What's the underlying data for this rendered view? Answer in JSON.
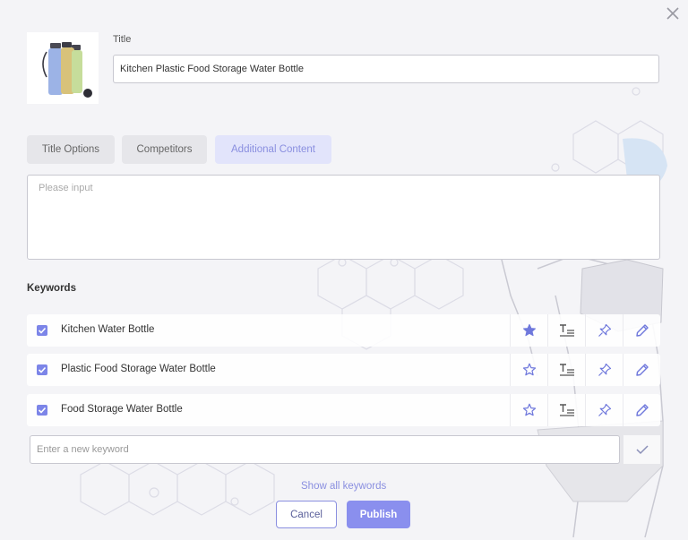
{
  "product": {
    "title_label": "Title",
    "title_value": "Kitchen Plastic Food Storage Water Bottle"
  },
  "tabs": [
    {
      "label": "Title Options",
      "active": false
    },
    {
      "label": "Competitors",
      "active": false
    },
    {
      "label": "Additional Content",
      "active": true
    }
  ],
  "content": {
    "placeholder": "Please input",
    "value": ""
  },
  "keywords": {
    "heading": "Keywords",
    "items": [
      {
        "label": "Kitchen Water Bottle",
        "checked": true,
        "starred": true
      },
      {
        "label": "Plastic Food Storage Water Bottle",
        "checked": true,
        "starred": false
      },
      {
        "label": "Food Storage Water Bottle",
        "checked": true,
        "starred": false
      }
    ],
    "new_placeholder": "Enter a new keyword",
    "show_all": "Show all keywords"
  },
  "actions": {
    "cancel": "Cancel",
    "publish": "Publish"
  },
  "icons": {
    "close": "close-icon",
    "check": "checkbox-check-icon",
    "star": "star-icon",
    "format": "text-format-icon",
    "pin": "pin-icon",
    "edit": "pencil-icon",
    "confirm": "checkmark-icon"
  },
  "colors": {
    "accent": "#8a8fee",
    "accent_text": "#8a8fe0",
    "tab_active_bg": "#e2e4fb",
    "tab_bg": "#e6e6ea"
  }
}
